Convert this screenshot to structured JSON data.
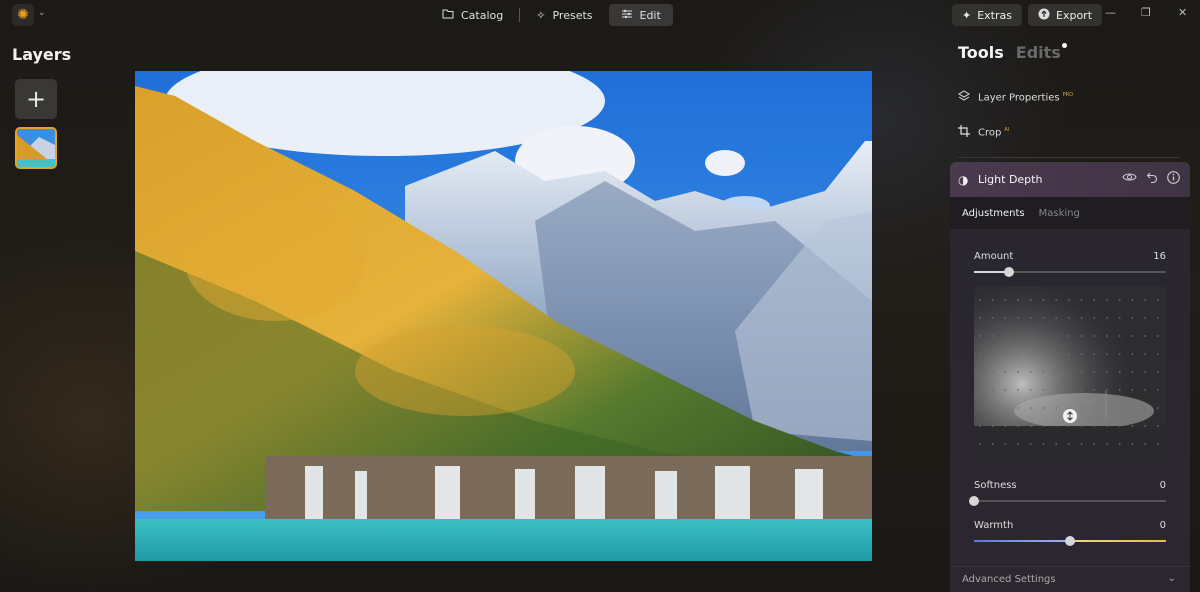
{
  "app": {
    "logo_icon": "sun-logo-icon",
    "accent": "#e9a521"
  },
  "nav": {
    "items": [
      {
        "label": "Catalog",
        "icon": "folder-icon"
      },
      {
        "label": "Presets",
        "icon": "sparkle-icon"
      },
      {
        "label": "Edit",
        "icon": "sliders-icon",
        "active": true
      }
    ]
  },
  "top_right": {
    "extras_label": "Extras",
    "export_label": "Export"
  },
  "layers": {
    "title": "Layers"
  },
  "panel": {
    "tab_tools": "Tools",
    "tab_edits": "Edits",
    "tools": [
      {
        "label": "Layer Properties",
        "badge": "PRO"
      },
      {
        "label": "Crop",
        "badge": "AI"
      }
    ],
    "light_depth": {
      "title": "Light Depth",
      "sub_tabs": [
        "Adjustments",
        "Masking"
      ],
      "amount": {
        "label": "Amount",
        "value": "16",
        "fraction": 0.18
      },
      "softness": {
        "label": "Softness",
        "value": "0",
        "fraction": 0.0
      },
      "warmth": {
        "label": "Warmth",
        "value": "0",
        "fraction": 0.5
      },
      "advanced_label": "Advanced Settings"
    }
  }
}
